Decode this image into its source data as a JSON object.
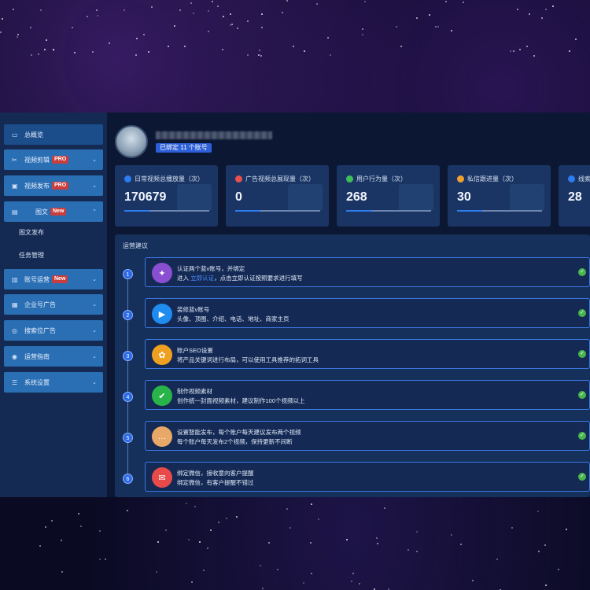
{
  "colors": {
    "accent": "#2d7cf0",
    "sidebar_button": "#2a6fb3",
    "tag_red": "#c83d3d",
    "check_green": "#48b54d"
  },
  "sidebar": {
    "items": [
      {
        "label": "总概览",
        "icon": "monitor-icon",
        "tag": "",
        "chevron": ""
      },
      {
        "label": "视频剪辑",
        "icon": "scissors-icon",
        "tag": "PRO",
        "chevron": "⌄"
      },
      {
        "label": "视频发布",
        "icon": "video-icon",
        "tag": "PRO",
        "chevron": "⌄"
      },
      {
        "label": "图文",
        "icon": "document-icon",
        "tag": "New",
        "chevron": "⌃"
      },
      {
        "label": "账号运营",
        "icon": "chart-icon",
        "tag": "New",
        "chevron": "⌄"
      },
      {
        "label": "企业号广告",
        "icon": "briefcase-icon",
        "tag": "",
        "chevron": "⌄"
      },
      {
        "label": "搜索位广告",
        "icon": "search-circle-icon",
        "tag": "",
        "chevron": "⌄"
      },
      {
        "label": "运营指南",
        "icon": "compass-icon",
        "tag": "",
        "chevron": "⌄"
      },
      {
        "label": "系统设置",
        "icon": "settings-icon",
        "tag": "",
        "chevron": "⌄"
      }
    ],
    "subitems": [
      "图文发布",
      "任务管理"
    ]
  },
  "profile": {
    "bound_badge": "已绑定 11 个账号"
  },
  "stats": [
    {
      "label": "日常视频总播放量（次）",
      "value": "170679",
      "color": "#2d7cf0",
      "icon": "play-icon"
    },
    {
      "label": "广告视频总展现量（次）",
      "value": "0",
      "color": "#e85050",
      "icon": "play-icon"
    },
    {
      "label": "用户行为量（次）",
      "value": "268",
      "color": "#3fbf5a",
      "icon": "user-icon"
    },
    {
      "label": "私信跟进量（次）",
      "value": "30",
      "color": "#f0a030",
      "icon": "mail-icon"
    },
    {
      "label": "线索",
      "value": "28",
      "color": "#2d7cf0",
      "icon": "clue-icon"
    }
  ],
  "advice": {
    "title": "运营建议",
    "steps": [
      {
        "num": "1",
        "title": "认证两个蓝v账号，并绑定",
        "desc_pre": "进入 ",
        "desc_link": "立即认证",
        "desc_post": "，点击立即认证按照要求进行填写",
        "icon_bg": "#8a4fd0",
        "icon": "user-badge-icon",
        "glyph": "✦"
      },
      {
        "num": "2",
        "title": "装修蓝v账号",
        "desc_pre": "头像、顶图、介绍、电话、地址、商家主页",
        "desc_link": "",
        "desc_post": "",
        "icon_bg": "#1f8cf0",
        "icon": "video-camera-icon",
        "glyph": "▶"
      },
      {
        "num": "3",
        "title": "账户SEO设置",
        "desc_pre": "将产品关键词进行布局，可以使用工具推荐的拓词工具",
        "desc_link": "",
        "desc_post": "",
        "icon_bg": "#f0a020",
        "icon": "seo-icon",
        "glyph": "✿"
      },
      {
        "num": "4",
        "title": "制作视频素材",
        "desc_pre": "创作统一封面视频素材，建议制作100个视频以上",
        "desc_link": "",
        "desc_post": "",
        "icon_bg": "#29b44a",
        "icon": "thumbs-up-icon",
        "glyph": "✔"
      },
      {
        "num": "5",
        "title": "设置智能发布，每个账户每天建议发布两个视频",
        "desc_pre": "每个账户每天发布2个视频，保持更新不间断",
        "desc_link": "",
        "desc_post": "",
        "icon_bg": "#e8a868",
        "icon": "message-icon",
        "glyph": "…"
      },
      {
        "num": "6",
        "title": "绑定微信，接收意向客户提醒",
        "desc_pre": "绑定微信，有客户提醒不错过",
        "desc_link": "",
        "desc_post": "",
        "icon_bg": "#e84a4a",
        "icon": "mail-icon",
        "glyph": "✉"
      }
    ]
  }
}
